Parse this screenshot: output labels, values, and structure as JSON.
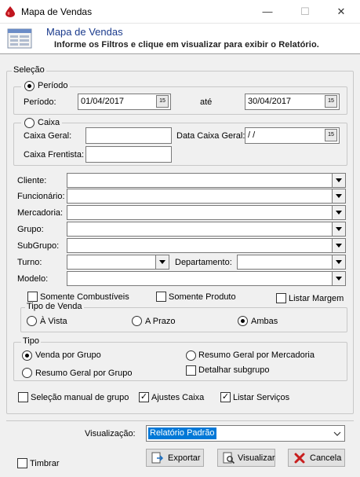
{
  "window": {
    "title": "Mapa de Vendas",
    "minimize": "—",
    "maximize": "☐",
    "close": "✕"
  },
  "header": {
    "title": "Mapa de Vendas",
    "subtitle": "Informe os Filtros e clique em visualizar para exibir o Relatório."
  },
  "selecao": {
    "label": "Seleção",
    "periodo": {
      "radio_label": "Período",
      "selected": true,
      "field_label": "Período:",
      "start": "01/04/2017",
      "ate_label": "até",
      "end": "30/04/2017"
    },
    "caixa": {
      "radio_label": "Caixa",
      "selected": false,
      "caixa_geral_label": "Caixa Geral:",
      "caixa_geral_value": "",
      "data_caixa_label": "Data Caixa Geral:",
      "data_caixa_value": " / /",
      "caixa_frentista_label": "Caixa Frentista:",
      "caixa_frentista_value": ""
    },
    "filters": {
      "cliente": "Cliente:",
      "funcionario": "Funcionário:",
      "mercadoria": "Mercadoria:",
      "grupo": "Grupo:",
      "subgrupo": "SubGrupo:",
      "turno": "Turno:",
      "departamento": "Departamento:",
      "modelo": "Modelo:"
    },
    "checks": {
      "somente_combustiveis": {
        "label": "Somente Combustíveis",
        "checked": false
      },
      "somente_produto": {
        "label": "Somente Produto",
        "checked": false
      },
      "listar_margem": {
        "label": "Listar Margem",
        "checked": false
      }
    },
    "tipo_venda": {
      "label": "Tipo de Venda",
      "options": [
        "À Vista",
        "A Prazo",
        "Ambas"
      ],
      "selected": "Ambas"
    },
    "tipo": {
      "label": "Tipo",
      "venda_por_grupo": "Venda por Grupo",
      "resumo_geral_mercadoria": "Resumo Geral por Mercadoria",
      "resumo_geral_grupo": "Resumo Geral por Grupo",
      "detalhar_subgrupo": "Detalhar subgrupo",
      "selected": "Venda por Grupo"
    },
    "bottom_checks": {
      "selecao_manual": {
        "label": "Seleção manual de grupo",
        "checked": false
      },
      "ajustes_caixa": {
        "label": "Ajustes Caixa",
        "checked": true
      },
      "listar_servicos": {
        "label": "Listar Serviços",
        "checked": true
      }
    }
  },
  "footer": {
    "visualizacao_label": "Visualização:",
    "visualizacao_value": "Relatório Padrão",
    "timbrar": {
      "label": "Timbrar",
      "checked": false
    },
    "exportar": "Exportar",
    "visualizar": "Visualizar",
    "cancelar": "Cancela"
  },
  "colors": {
    "accent_blue": "#1a3a8c",
    "selection_blue": "#0078d7",
    "cancel_red": "#c81e1e"
  }
}
